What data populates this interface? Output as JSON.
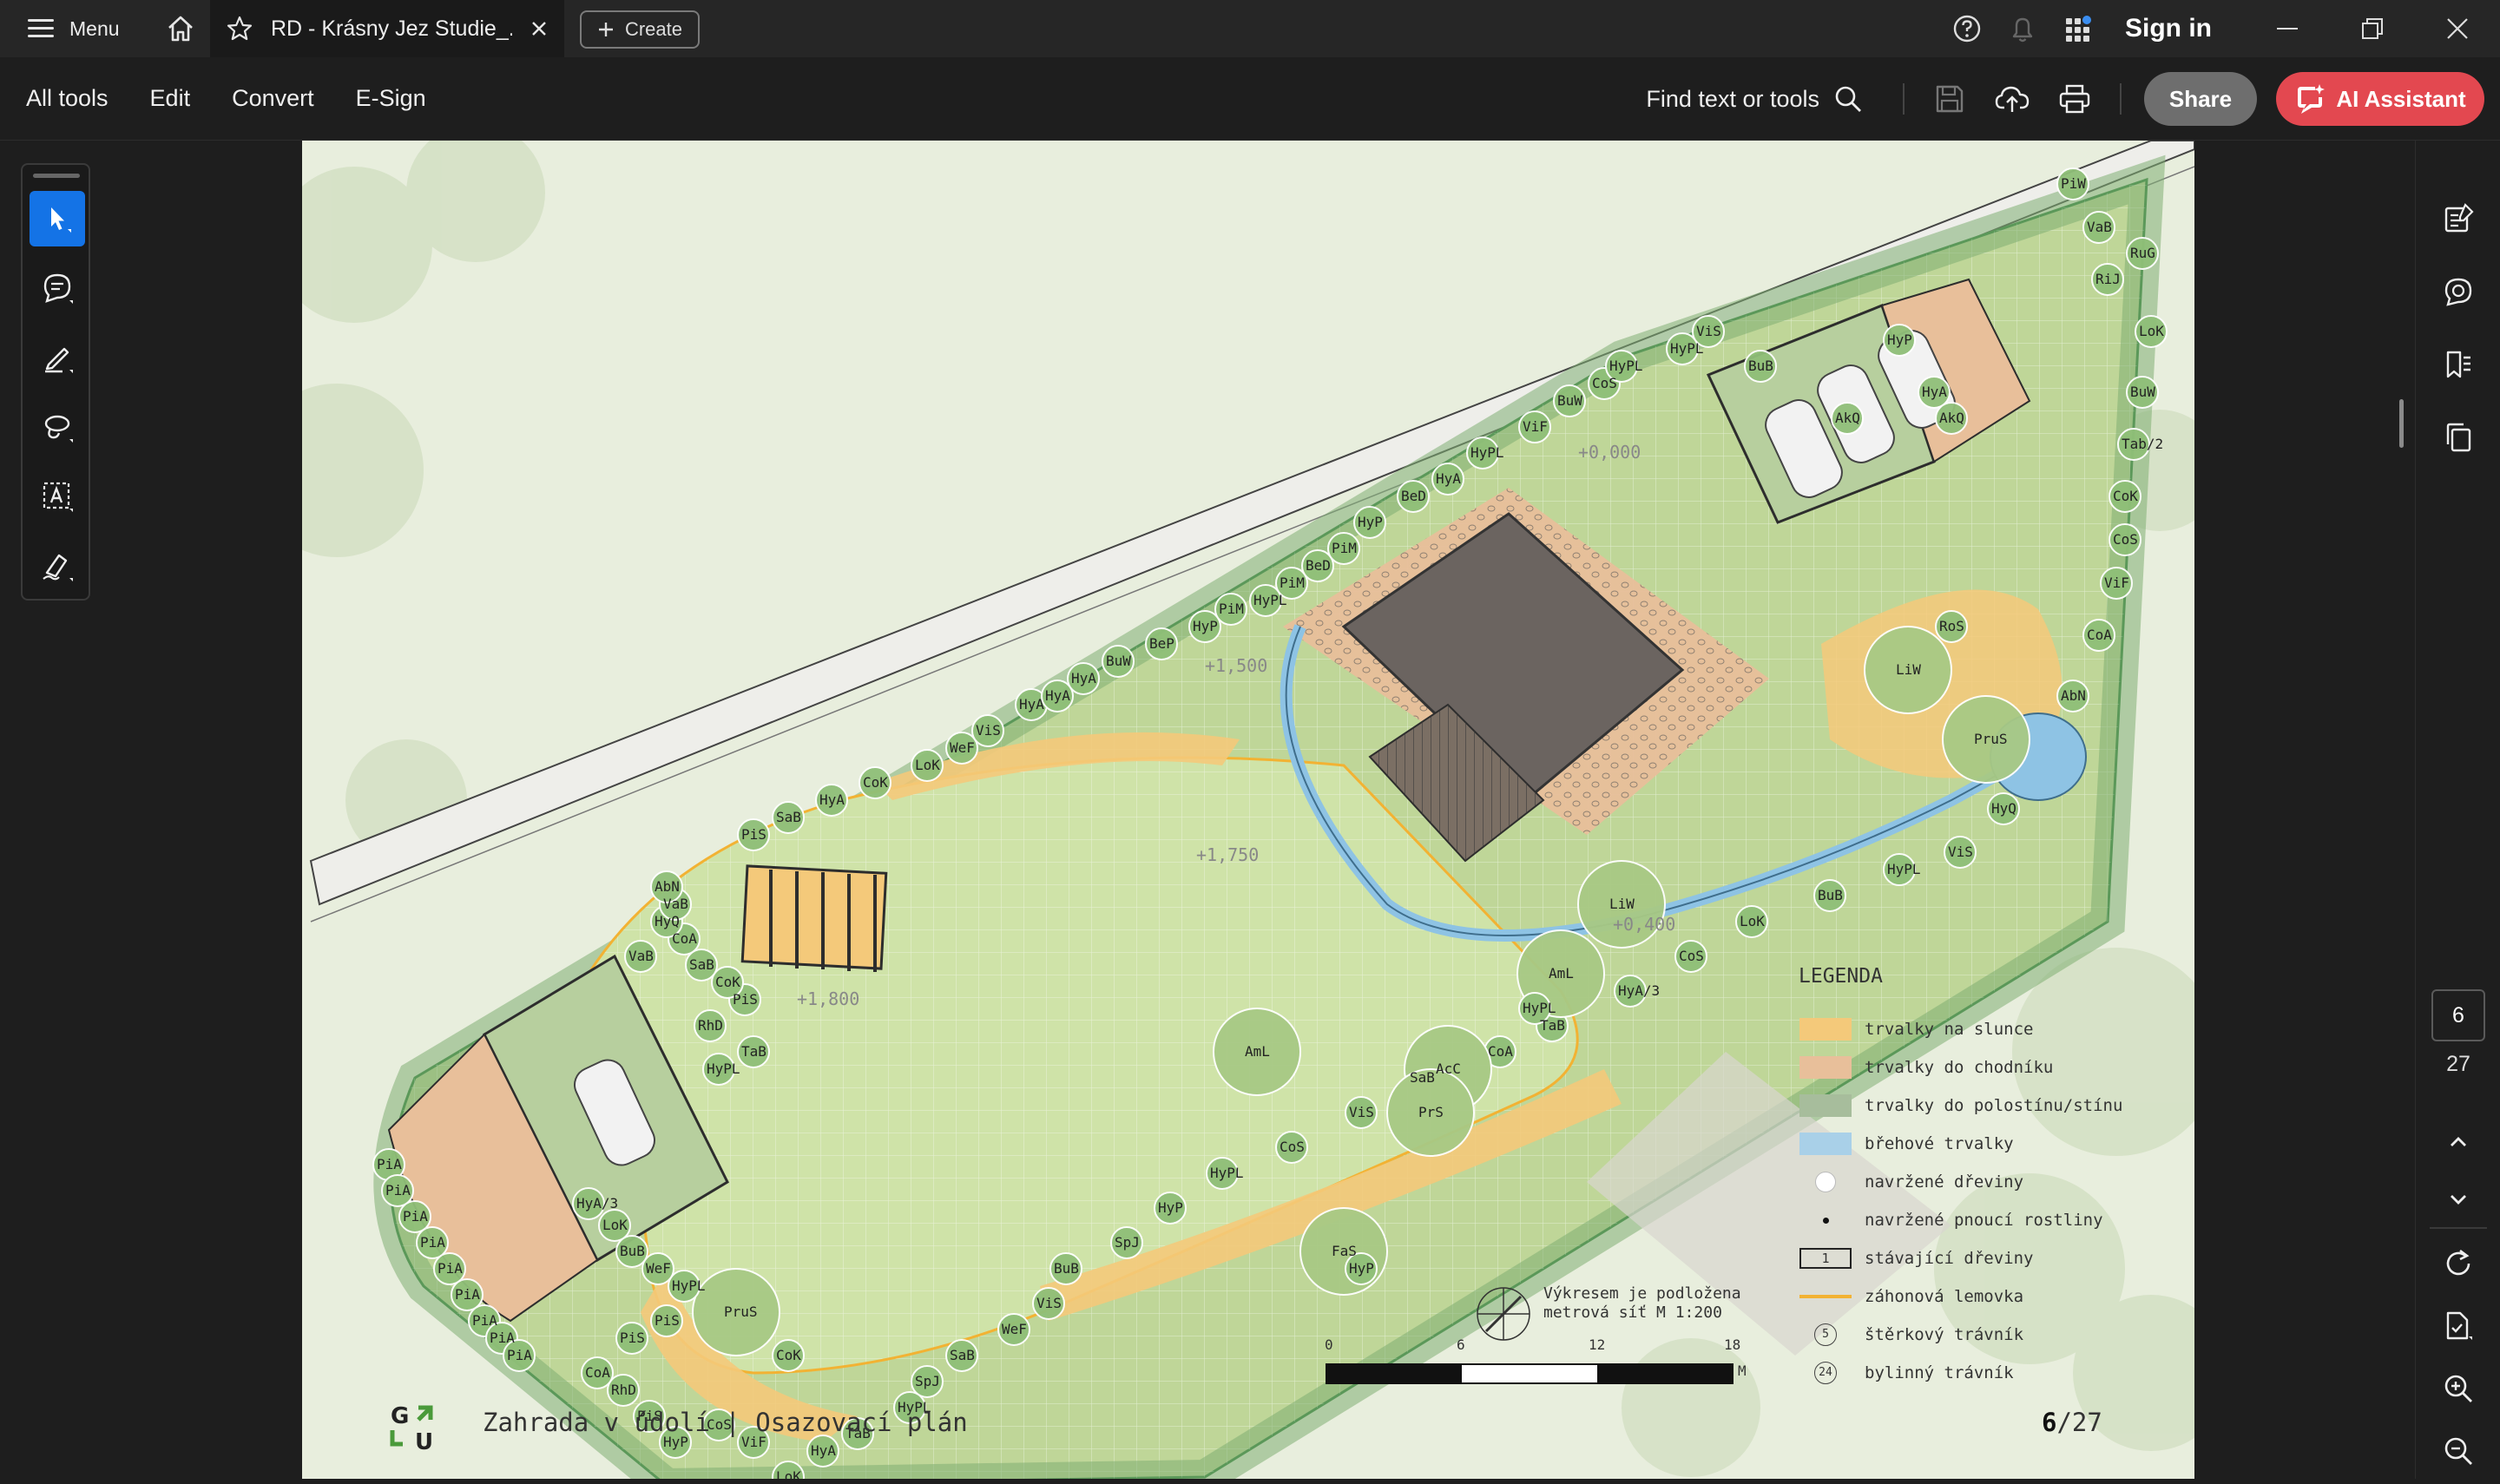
{
  "titlebar": {
    "menu_label": "Menu",
    "tab_title": "RD - Krásny Jez Studie_...",
    "create_label": "Create",
    "signin_label": "Sign in",
    "icons": [
      "help-icon",
      "bell-icon",
      "apps-grid-icon"
    ]
  },
  "toolbar": {
    "menu_items": [
      "All tools",
      "Edit",
      "Convert",
      "E-Sign"
    ],
    "find_label": "Find text or tools",
    "share_label": "Share",
    "ai_label": "AI Assistant",
    "accent": "#e34850",
    "select_color": "#1473e6"
  },
  "document": {
    "footer_title": "Zahrada v údolí | Osazovací plán",
    "page_current": "6",
    "page_sep": "/27",
    "logo_letters": "GAU",
    "legend_title": "LEGENDA",
    "legend": [
      {
        "label": "trvalky na slunce",
        "color": "#f4c97a",
        "kind": "fill"
      },
      {
        "label": "trvalky do chodníku",
        "color": "#e8bf9a",
        "kind": "fill"
      },
      {
        "label": "trvalky do polostínu/stínu",
        "color": "#a7bd9c",
        "kind": "fill"
      },
      {
        "label": "břehové trvalky",
        "color": "#a9d0e8",
        "kind": "fill"
      },
      {
        "label": "navržené dřeviny",
        "kind": "circle"
      },
      {
        "label": "navržené pnoucí rostliny",
        "kind": "dot"
      },
      {
        "label": "stávající dřeviny",
        "kind": "box",
        "symbol": "1"
      },
      {
        "label": "záhonová lemovka",
        "color": "#f2b233",
        "kind": "line"
      },
      {
        "label": "štěrkový trávník",
        "kind": "num",
        "symbol": "5"
      },
      {
        "label": "bylinný trávník",
        "kind": "num",
        "symbol": "24"
      }
    ],
    "scale_note_1": "Výkresem je podložena",
    "scale_note_2": "metrová síť   M 1:200",
    "scale_ticks": [
      "0",
      "6",
      "12",
      "18"
    ],
    "scale_unit": "M",
    "levels": [
      "+1,500",
      "+1,750",
      "+1,800",
      "+0,400",
      "+0,000"
    ],
    "plant_labels": [
      {
        "t": "PiW"
      },
      {
        "t": "VaB"
      },
      {
        "t": "RuG"
      },
      {
        "t": "RiJ"
      },
      {
        "t": "LoK"
      },
      {
        "t": "BuW"
      },
      {
        "t": "Tab/2"
      },
      {
        "t": "CoK"
      },
      {
        "t": "CoS"
      },
      {
        "t": "ViF"
      },
      {
        "t": "CoA"
      },
      {
        "t": "AbN"
      },
      {
        "t": "HyQ"
      },
      {
        "t": "ViS"
      },
      {
        "t": "HyPL"
      },
      {
        "t": "BuB"
      },
      {
        "t": "LoK"
      },
      {
        "t": "CoS"
      },
      {
        "t": "HyA/3"
      },
      {
        "t": "TaB"
      },
      {
        "t": "CoA"
      },
      {
        "t": "SaB"
      },
      {
        "t": "ViS"
      },
      {
        "t": "CoS"
      },
      {
        "t": "HyPL"
      },
      {
        "t": "HyP"
      },
      {
        "t": "SpJ"
      },
      {
        "t": "BuB"
      },
      {
        "t": "ViS"
      },
      {
        "t": "WeF"
      },
      {
        "t": "SaB"
      },
      {
        "t": "SpJ"
      },
      {
        "t": "HyPL"
      },
      {
        "t": "TaB"
      },
      {
        "t": "HyA"
      },
      {
        "t": "LoK"
      },
      {
        "t": "ViF"
      },
      {
        "t": "CoS"
      },
      {
        "t": "HyP"
      },
      {
        "t": "PiS"
      },
      {
        "t": "RhD"
      },
      {
        "t": "CoA"
      },
      {
        "t": "PiS"
      },
      {
        "t": "PiS"
      },
      {
        "t": "CoK"
      },
      {
        "t": "PruS"
      },
      {
        "t": "HyPL"
      },
      {
        "t": "WeF"
      },
      {
        "t": "BuB"
      },
      {
        "t": "LoK"
      },
      {
        "t": "HyA/3"
      },
      {
        "t": "PiA"
      },
      {
        "t": "PiA"
      },
      {
        "t": "PiA"
      },
      {
        "t": "PiA"
      },
      {
        "t": "PiA"
      },
      {
        "t": "PiA"
      },
      {
        "t": "PiA"
      },
      {
        "t": "PiA"
      },
      {
        "t": "PiA"
      },
      {
        "t": "HyPL"
      },
      {
        "t": "TaB"
      },
      {
        "t": "RhD"
      },
      {
        "t": "PiS"
      },
      {
        "t": "CoK"
      },
      {
        "t": "SaB"
      },
      {
        "t": "VaB"
      },
      {
        "t": "CoA"
      },
      {
        "t": "HyQ"
      },
      {
        "t": "VaB"
      },
      {
        "t": "AbN"
      },
      {
        "t": "PiS"
      },
      {
        "t": "SaB"
      },
      {
        "t": "HyA"
      },
      {
        "t": "CoK"
      },
      {
        "t": "LoK"
      },
      {
        "t": "WeF"
      },
      {
        "t": "ViS"
      },
      {
        "t": "HyA"
      },
      {
        "t": "HyA"
      },
      {
        "t": "HyA"
      },
      {
        "t": "BuW"
      },
      {
        "t": "BeP"
      },
      {
        "t": "HyP"
      },
      {
        "t": "PiM"
      },
      {
        "t": "HyPL"
      },
      {
        "t": "PiM"
      },
      {
        "t": "BeD"
      },
      {
        "t": "PiM"
      },
      {
        "t": "HyP"
      },
      {
        "t": "BeD"
      },
      {
        "t": "HyA"
      },
      {
        "t": "HyPL"
      },
      {
        "t": "ViF"
      },
      {
        "t": "BuW"
      },
      {
        "t": "CoS"
      },
      {
        "t": "HyPL"
      },
      {
        "t": "HyPL"
      },
      {
        "t": "ViS"
      },
      {
        "t": "BuB"
      },
      {
        "t": "HyP"
      },
      {
        "t": "HyA"
      },
      {
        "t": "AkQ"
      },
      {
        "t": "AkQ"
      },
      {
        "t": "RoS"
      },
      {
        "t": "LiW"
      },
      {
        "t": "PruS"
      },
      {
        "t": "LiW"
      },
      {
        "t": "AmL"
      },
      {
        "t": "AcC"
      },
      {
        "t": "PrS"
      },
      {
        "t": "FaS"
      },
      {
        "t": "AmL"
      },
      {
        "t": "HyPL"
      },
      {
        "t": "HyP"
      }
    ]
  },
  "right_panel": {
    "page_current": "6",
    "page_total": "27"
  }
}
